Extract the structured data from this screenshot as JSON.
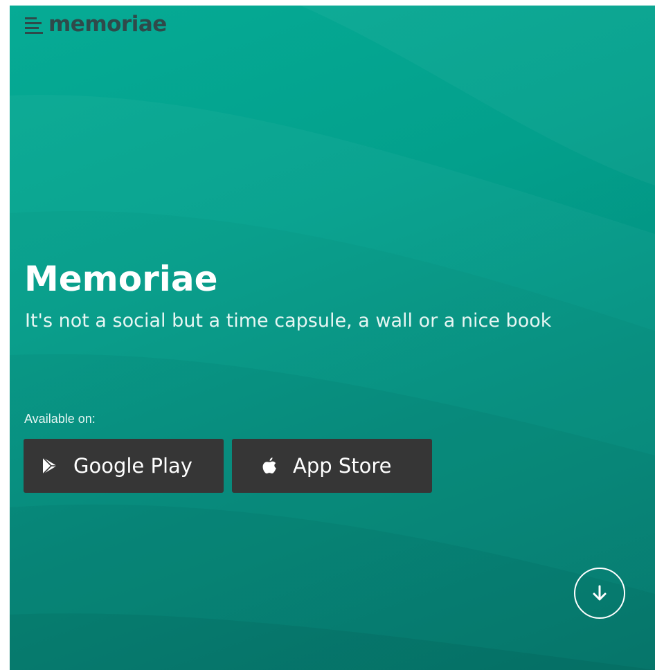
{
  "brand": {
    "name": "memoriae",
    "icon": "menu-lines-icon",
    "color": "#2f4a4a"
  },
  "hero": {
    "title": "Memoriae",
    "subtitle": "It's not a social but a time capsule, a wall or a nice book",
    "background_color": "#03a08c"
  },
  "availability": {
    "label": "Available on:",
    "stores": [
      {
        "label": "Google Play",
        "icon": "google-play-icon"
      },
      {
        "label": "App Store",
        "icon": "apple-icon"
      }
    ],
    "button_color": "#363636"
  },
  "scroll_button": {
    "icon": "arrow-down-icon"
  }
}
